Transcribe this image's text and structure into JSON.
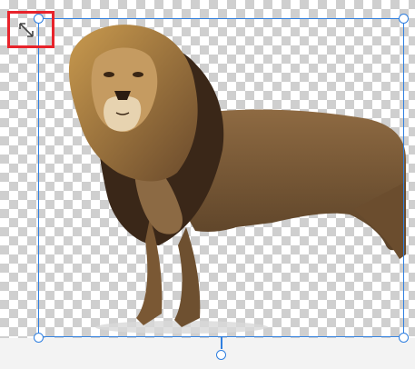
{
  "canvas": {
    "background": "transparent-checkerboard",
    "image_subject": "lion"
  },
  "selection": {
    "color": "#2f7fe0",
    "handles": [
      "top-left",
      "top-right",
      "bottom-left",
      "bottom-right",
      "rotate-bottom-center"
    ]
  },
  "highlight": {
    "color": "#e8232b",
    "icon": "resize-diagonal-icon"
  }
}
